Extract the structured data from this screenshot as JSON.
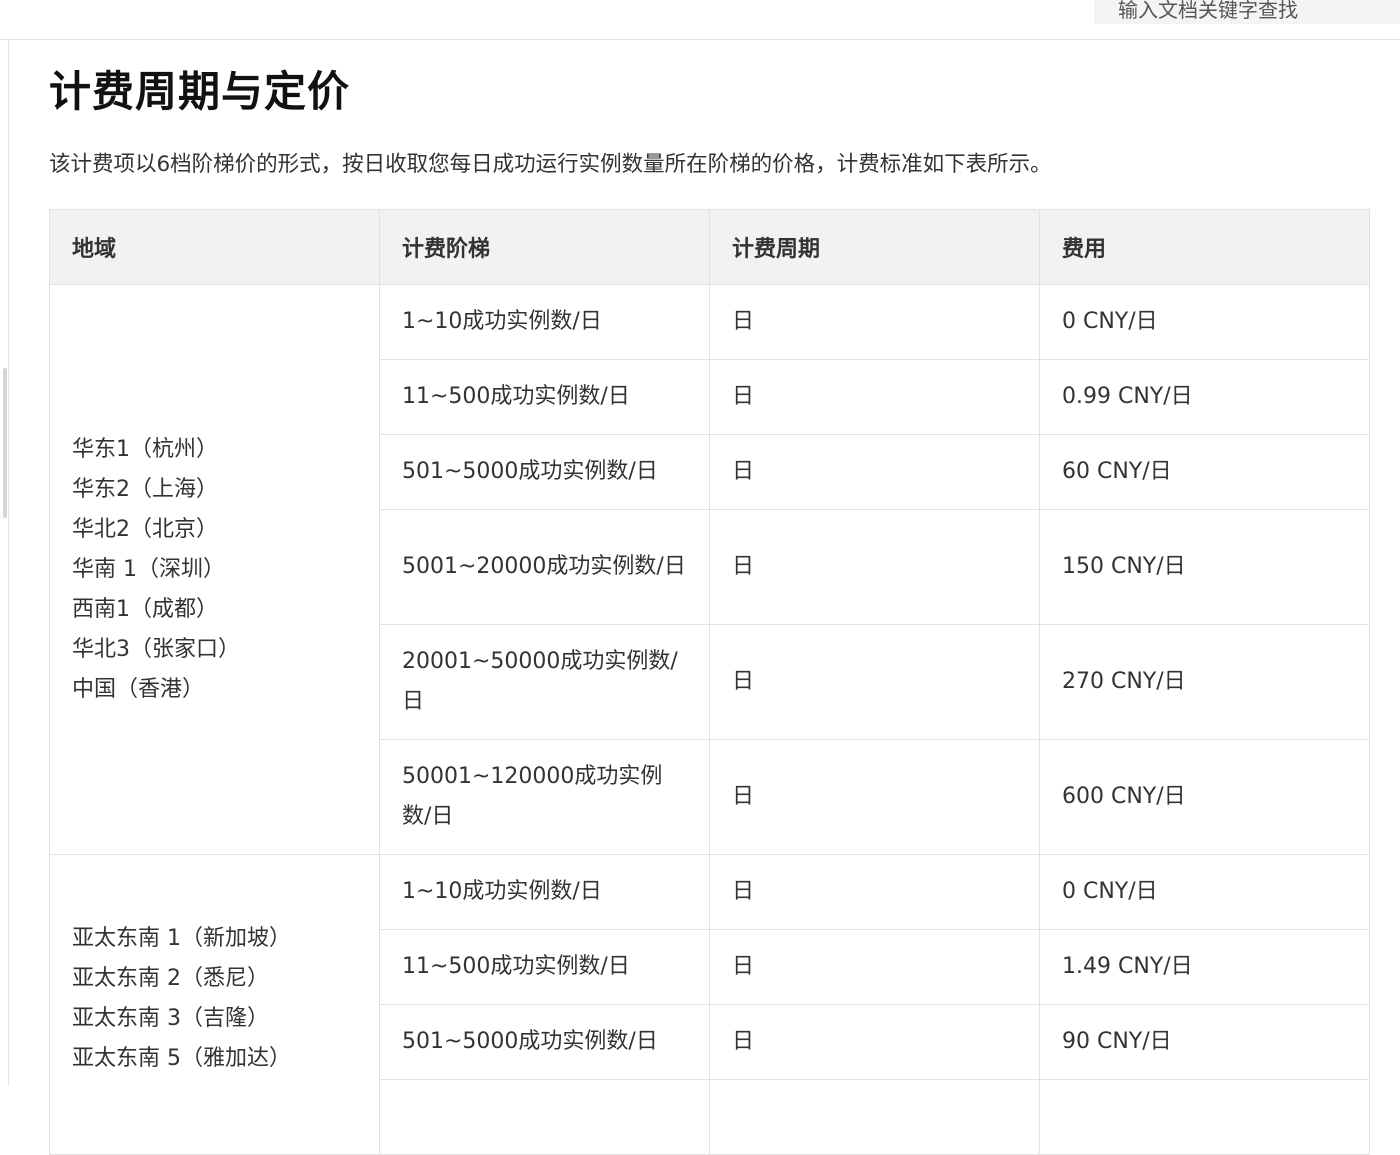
{
  "header": {
    "search_placeholder": "输入文档关键字查找"
  },
  "page": {
    "title": "计费周期与定价",
    "intro": "该计费项以6档阶梯价的形式，按日收取您每日成功运行实例数量所在阶梯的价格，计费标准如下表所示。"
  },
  "table": {
    "headers": [
      "地域",
      "计费阶梯",
      "计费周期",
      "费用"
    ],
    "groups": [
      {
        "regions": [
          "华东1（杭州）",
          "华东2（上海）",
          "华北2（北京）",
          "华南 1（深圳）",
          "西南1（成都）",
          "华北3（张家口）",
          "中国（香港）"
        ],
        "rows": [
          {
            "tier": "1~10成功实例数/日",
            "period": "日",
            "fee": "0 CNY/日"
          },
          {
            "tier": "11~500成功实例数/日",
            "period": "日",
            "fee": "0.99 CNY/日"
          },
          {
            "tier": "501~5000成功实例数/日",
            "period": "日",
            "fee": "60 CNY/日"
          },
          {
            "tier": "5001~20000成功实例数/日",
            "period": "日",
            "fee": "150 CNY/日"
          },
          {
            "tier": "20001~50000成功实例数/日",
            "period": "日",
            "fee": "270 CNY/日"
          },
          {
            "tier": "50001~120000成功实例数/日",
            "period": "日",
            "fee": "600 CNY/日"
          }
        ]
      },
      {
        "regions": [
          "亚太东南 1（新加坡）",
          "亚太东南 2（悉尼）",
          "亚太东南 3（吉隆）",
          "亚太东南 5（雅加达）"
        ],
        "rows": [
          {
            "tier": "1~10成功实例数/日",
            "period": "日",
            "fee": "0 CNY/日"
          },
          {
            "tier": "11~500成功实例数/日",
            "period": "日",
            "fee": "1.49 CNY/日"
          },
          {
            "tier": "501~5000成功实例数/日",
            "period": "日",
            "fee": "90 CNY/日"
          }
        ]
      }
    ]
  }
}
